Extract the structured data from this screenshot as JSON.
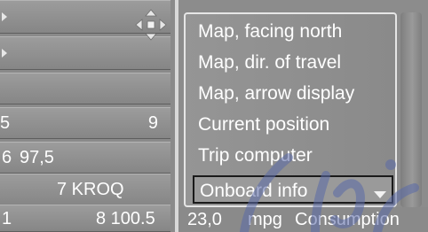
{
  "left_panel": {
    "rows": [
      {
        "num": "",
        "name": ""
      },
      {
        "num": "",
        "name": ""
      },
      {
        "num": "",
        "name": ""
      },
      {
        "num": "5",
        "name": "9"
      },
      {
        "num": "6",
        "name": "97,5"
      },
      {
        "num": "",
        "name": "7 KROQ"
      },
      {
        "num": "1",
        "name": "8 100.5"
      }
    ]
  },
  "menu": {
    "items": [
      "Map, facing north",
      "Map, dir. of travel",
      "Map, arrow display",
      "Current position",
      "Trip computer"
    ],
    "selected": "Onboard info"
  },
  "status": {
    "value": "23,0",
    "unit": "mpg",
    "label": "Consumption"
  },
  "icons": {
    "compass": "compass-arrows-icon",
    "row_pointer": "chevron-right-icon",
    "selection_arrow": "triangle-down-icon"
  },
  "colors": {
    "screen": "#8e8e8e",
    "text": "#ffffff",
    "selection_border": "#1a1a1a",
    "panel_border": "#e6e6e6"
  }
}
